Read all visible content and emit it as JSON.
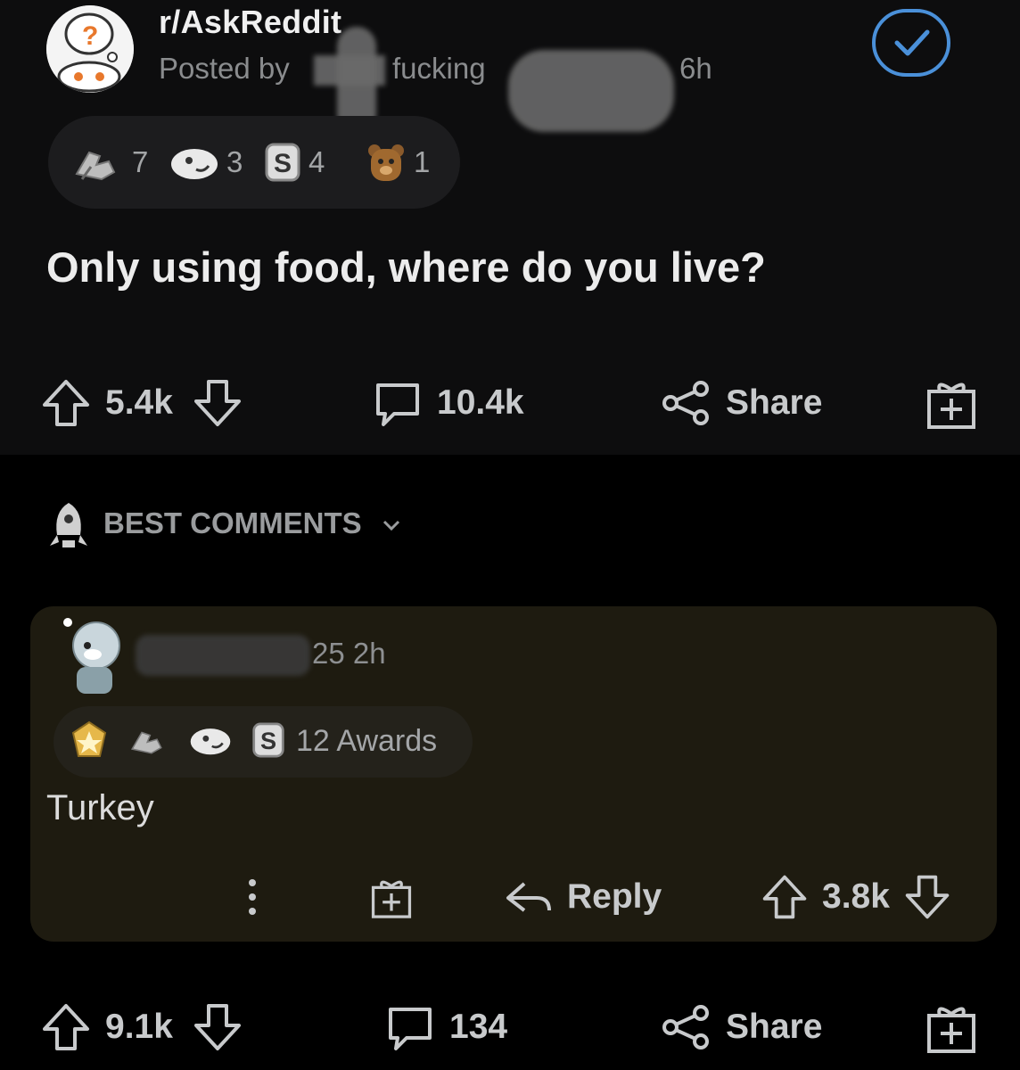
{
  "post": {
    "subreddit": "r/AskReddit",
    "posted_by_prefix": "Posted by",
    "username_fragment": "fucking",
    "time": "6h",
    "awards": [
      {
        "icon": "wholesome-award-icon",
        "count": "7"
      },
      {
        "icon": "helpful-award-icon",
        "count": "3"
      },
      {
        "icon": "silver-coin-award-icon",
        "count": "4"
      },
      {
        "icon": "bear-award-icon",
        "count": "1"
      }
    ],
    "title": "Only using food, where do you live?",
    "upvotes": "5.4k",
    "comments": "10.4k",
    "share_label": "Share"
  },
  "comments_header": {
    "sort_label": "BEST COMMENTS"
  },
  "comment": {
    "meta_points": "25",
    "meta_time": "2h",
    "awards_label": "12 Awards",
    "body": "Turkey",
    "reply_label": "Reply",
    "votes": "3.8k"
  },
  "next_post_actions": {
    "upvotes": "9.1k",
    "comments": "134",
    "share_label": "Share"
  },
  "colors": {
    "background": "#000000",
    "post_bg": "#0d0d0e",
    "comment_bg": "#1e1b10",
    "join_accent": "#4a90d9",
    "text_muted": "#8a8c8e"
  }
}
